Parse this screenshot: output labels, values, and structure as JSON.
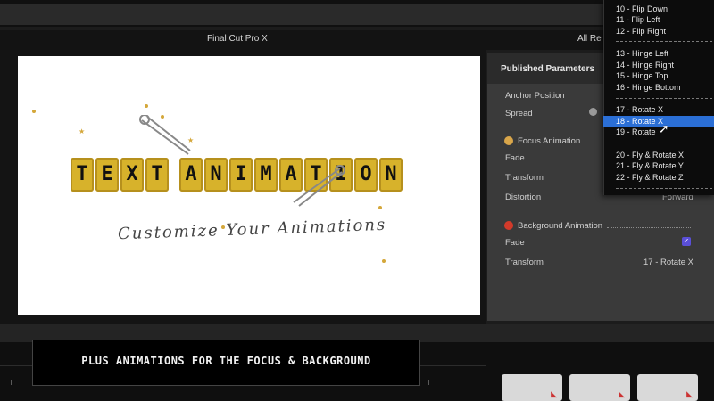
{
  "app": {
    "title": "Final Cut Pro X",
    "right_header_partial": "All Re"
  },
  "viewer": {
    "title_text_letters": [
      "T",
      "E",
      "X",
      "T",
      " ",
      "A",
      "N",
      "I",
      "M",
      "A",
      "T",
      "I",
      "O",
      "N"
    ],
    "subtitle": "Customize Your Animations"
  },
  "inspector": {
    "header": "Published Parameters",
    "anchor_position_label": "Anchor Position",
    "spread_label": "Spread",
    "focus_section_label": "Focus Animation",
    "focus_fade_label": "Fade",
    "focus_transform_label": "Transform",
    "distortion_label": "Distortion",
    "distortion_value": "Forward",
    "background_section_label": "Background Animation",
    "bg_fade_label": "Fade",
    "bg_fade_checked": true,
    "bg_transform_label": "Transform",
    "bg_transform_value": "17 - Rotate X",
    "focus_icon_color": "#d9a64a",
    "background_icon_color": "#d23a2a"
  },
  "dropdown": {
    "items": [
      {
        "label": "10 - Flip Down"
      },
      {
        "label": "11 - Flip Left"
      },
      {
        "label": "12 - Flip Right"
      },
      {
        "label": "13 - Hinge Left"
      },
      {
        "label": "14 - Hinge Right"
      },
      {
        "label": "15 - Hinge Top"
      },
      {
        "label": "16 - Hinge Bottom"
      },
      {
        "label": "17 - Rotate X"
      },
      {
        "label": "18 - Rotate X"
      },
      {
        "label": "19 - Rotate"
      },
      {
        "label": "20 - Fly & Rotate X"
      },
      {
        "label": "21 - Fly & Rotate Y"
      },
      {
        "label": "22 - Fly & Rotate Z"
      }
    ],
    "selected_label": "18 - Rotate X",
    "selection_color": "#2b6fd6"
  },
  "caption": {
    "text": "PLUS ANIMATIONS FOR THE FOCUS & BACKGROUND"
  }
}
